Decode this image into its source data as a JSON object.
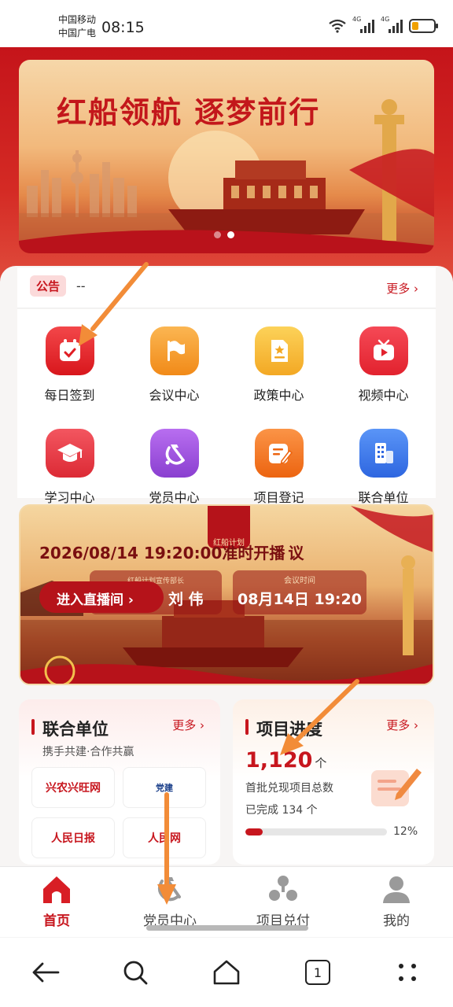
{
  "status_bar": {
    "carrier1": "中国移动",
    "carrier2": "中国广电",
    "time": "08:15",
    "net1": "4G",
    "net2": "4G"
  },
  "banner": {
    "title": "红船领航  逐梦前行",
    "slide_count": 2,
    "active_slide": 2
  },
  "notice": {
    "tag": "公告",
    "text": "--",
    "more": "更多"
  },
  "grid": [
    {
      "label": "每日签到",
      "icon": "calendar-check-icon",
      "color": "#e8262a"
    },
    {
      "label": "会议中心",
      "icon": "flag-icon",
      "color": "#f59a26"
    },
    {
      "label": "政策中心",
      "icon": "document-star-icon",
      "color": "#f5b82c"
    },
    {
      "label": "视频中心",
      "icon": "tv-play-icon",
      "color": "#ec2f3a"
    },
    {
      "label": "学习中心",
      "icon": "graduation-cap-icon",
      "color": "#ea3c45"
    },
    {
      "label": "党员中心",
      "icon": "hammer-sickle-icon",
      "color": "#9b4fd9"
    },
    {
      "label": "项目登记",
      "icon": "form-edit-icon",
      "color": "#f27a21"
    },
    {
      "label": "联合单位",
      "icon": "building-icon",
      "color": "#3d7bf0"
    }
  ],
  "live": {
    "badge": "红船计划",
    "headline": "2026/08/14 19:20:00准时开播",
    "headline_suffix": "议",
    "enter_label": "进入直播间",
    "speaker_role": "红船计划宣传部长",
    "speaker_name": "刘 伟",
    "time_label": "会议时间",
    "time_value": "08月14日 19:20"
  },
  "units_card": {
    "title": "联合单位",
    "more": "更多",
    "subtitle": "携手共建·合作共赢",
    "logos": [
      "兴农兴旺网",
      "党建",
      "人民日报",
      "人民网"
    ]
  },
  "progress_card": {
    "title": "项目进度",
    "more": "更多",
    "total": "1,120",
    "unit": "个",
    "desc": "首批兑现项目总数",
    "done": "已完成 134 个",
    "percent_text": "12%",
    "percent": 12
  },
  "tabs": [
    {
      "label": "首页",
      "icon": "home-icon",
      "active": true
    },
    {
      "label": "党员中心",
      "icon": "hammer-sickle-icon",
      "active": false
    },
    {
      "label": "项目兑付",
      "icon": "org-chart-icon",
      "active": false
    },
    {
      "label": "我的",
      "icon": "user-icon",
      "active": false
    }
  ],
  "sysnav": {
    "tabs_count": "1"
  },
  "colors": {
    "primary": "#c7161e",
    "arrow": "#f28c38"
  }
}
